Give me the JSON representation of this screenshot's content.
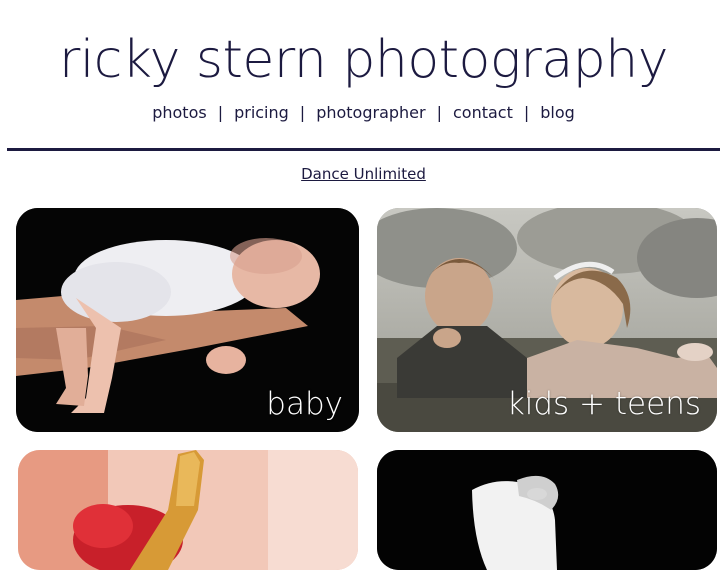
{
  "site": {
    "title": "ricky stern photography"
  },
  "nav": {
    "items": [
      {
        "label": "photos"
      },
      {
        "label": "pricing"
      },
      {
        "label": "photographer"
      },
      {
        "label": "contact"
      },
      {
        "label": "blog"
      }
    ],
    "separator": "|"
  },
  "featured": {
    "link_text": "Dance Unlimited"
  },
  "gallery": {
    "tiles": [
      {
        "caption": "baby"
      },
      {
        "caption": "kids + teens"
      },
      {
        "caption": ""
      },
      {
        "caption": ""
      }
    ]
  },
  "colors": {
    "brand": "#1c1a40",
    "background": "#ffffff"
  }
}
